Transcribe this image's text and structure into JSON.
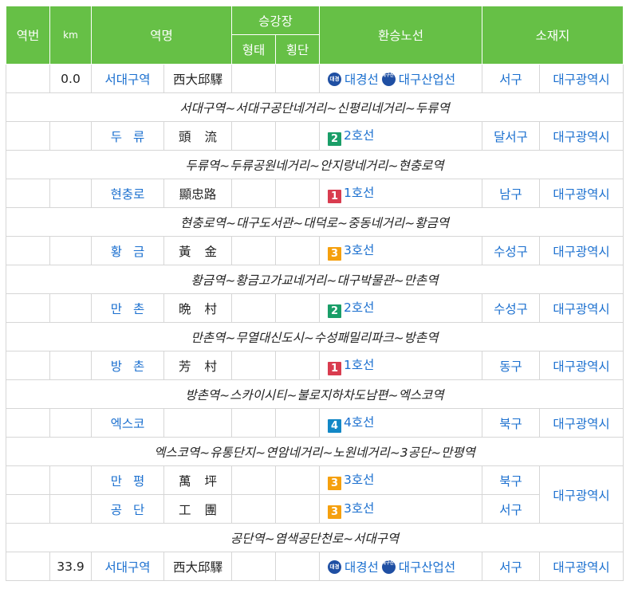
{
  "headers": {
    "no": "역번",
    "km": "km",
    "name": "역명",
    "platform": "승강장",
    "platform_form": "형태",
    "platform_cross": "횡단",
    "transfer": "환승노선",
    "location": "소재지"
  },
  "rows": [
    {
      "km": "0.0",
      "name": "서대구역",
      "hanja": "西大邱驛",
      "lines": [
        {
          "type": "circle",
          "icon": "대경",
          "label": "대경선"
        },
        {
          "type": "circle",
          "icon": "대구산업",
          "label": "대구산업선"
        }
      ],
      "district": "서구",
      "city": "대구광역시"
    },
    {
      "segment": "서대구역~서대구공단네거리~신평리네거리~두류역"
    },
    {
      "km": "",
      "name": "두류",
      "hanja": "頭流",
      "lines": [
        {
          "type": "badge",
          "num": "2",
          "label": "2호선"
        }
      ],
      "district": "달서구",
      "city": "대구광역시"
    },
    {
      "segment": "두류역~두류공원네거리~안지랑네거리~현충로역"
    },
    {
      "km": "",
      "name": "현충로",
      "hanja": "顯忠路",
      "lines": [
        {
          "type": "badge",
          "num": "1",
          "label": "1호선"
        }
      ],
      "district": "남구",
      "city": "대구광역시"
    },
    {
      "segment": "현충로역~대구도서관~대덕로~중동네거리~황금역"
    },
    {
      "km": "",
      "name": "황금",
      "hanja": "黃金",
      "lines": [
        {
          "type": "badge",
          "num": "3",
          "label": "3호선"
        }
      ],
      "district": "수성구",
      "city": "대구광역시"
    },
    {
      "segment": "황금역~황금고가교네거리~대구박물관~만촌역"
    },
    {
      "km": "",
      "name": "만촌",
      "hanja": "晩村",
      "lines": [
        {
          "type": "badge",
          "num": "2",
          "label": "2호선"
        }
      ],
      "district": "수성구",
      "city": "대구광역시"
    },
    {
      "segment": "만촌역~무열대신도시~수성패밀리파크~방촌역"
    },
    {
      "km": "",
      "name": "방촌",
      "hanja": "芳村",
      "lines": [
        {
          "type": "badge",
          "num": "1",
          "label": "1호선"
        }
      ],
      "district": "동구",
      "city": "대구광역시"
    },
    {
      "segment": "방촌역~스카이시티~불로지하차도남편~엑스코역"
    },
    {
      "km": "",
      "name": "엑스코",
      "hanja": "",
      "lines": [
        {
          "type": "badge",
          "num": "4",
          "label": "4호선"
        }
      ],
      "district": "북구",
      "city": "대구광역시"
    },
    {
      "segment": "엑스코역~유통단지~연암네거리~노원네거리~3공단~만평역"
    },
    {
      "km": "",
      "name": "만평",
      "hanja": "萬坪",
      "lines": [
        {
          "type": "badge",
          "num": "3",
          "label": "3호선"
        }
      ],
      "district": "북구",
      "city": "대구광역시"
    },
    {
      "km": "",
      "name": "공단",
      "hanja": "工團",
      "lines": [
        {
          "type": "badge",
          "num": "3",
          "label": "3호선"
        }
      ],
      "district": "서구",
      "city": ""
    },
    {
      "segment": "공단역~염색공단천로~서대구역"
    },
    {
      "km": "33.9",
      "name": "서대구역",
      "hanja": "西大邱驛",
      "lines": [
        {
          "type": "circle",
          "icon": "대경",
          "label": "대경선"
        },
        {
          "type": "circle",
          "icon": "대구산업",
          "label": "대구산업선"
        }
      ],
      "district": "서구",
      "city": "대구광역시"
    }
  ],
  "colors": {
    "header_bg": "#66c046",
    "link": "#1a6fcf",
    "line_1": "#d93c4f",
    "line_2": "#1a9e68",
    "line_3": "#f5a00e",
    "line_4": "#1287c6",
    "daegyeong": "#1f4fa3"
  }
}
